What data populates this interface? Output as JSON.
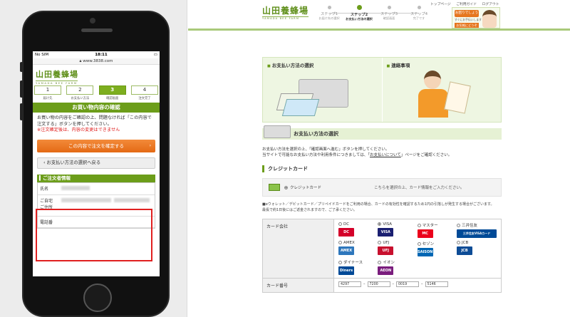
{
  "phone": {
    "status_carrier": "No SIM",
    "status_time": "18:11",
    "url": "www.3838.com",
    "logo_jp": "山田養蜂場",
    "logo_en": "YAMADA BEE FARM",
    "steps": [
      {
        "num": "1",
        "label": "届け先"
      },
      {
        "num": "2",
        "label": "お支払い方法"
      },
      {
        "num": "3",
        "label": "確認画面"
      },
      {
        "num": "4",
        "label": "注文完了"
      }
    ],
    "heading": "お買い物内容の確認",
    "desc": "お買い物の内容をご確認の上、問題なければ「この内容で注文する」ボタンを押してください。",
    "desc_red": "※注文確定後は、内容の変更はできません",
    "confirm_button": "この内容で注文を確定する",
    "back_button": "お支払い方法の選択へ戻る",
    "section": "ご注文者情報",
    "rows": [
      {
        "label": "氏名"
      },
      {
        "label": "ご自宅\nご住所"
      },
      {
        "label": "電話番"
      }
    ]
  },
  "desktop": {
    "logo_jp": "山田養蜂場",
    "logo_en": "YAMADA BEE FARM",
    "top_links": [
      "トップページ",
      "ご利用ガイド",
      "ログアウト"
    ],
    "steps": [
      {
        "title": "ステップ1",
        "sub": "お届け先の選択"
      },
      {
        "title": "ステップ2",
        "sub": "お支払い方法の選択"
      },
      {
        "title": "ステップ3",
        "sub": "確認画面"
      },
      {
        "title": "ステップ4",
        "sub": "完了です"
      }
    ],
    "banner": {
      "line1": "お困りでしょうか？",
      "line2": "すぐにお手伝いします",
      "btn": "お気軽にどうぞ"
    },
    "card_payment_title": "お支払い方法の選択",
    "card_contact_title": "連絡事項",
    "section_title": "お支払い方法の選択",
    "desc_line1": "お支払い方法を選択の上、「確認画面へ進む」ボタンを押してください。",
    "desc_line2_pre": "当サイトで可能なお支払い方法や利用条件につきましては、「",
    "desc_link": "お支払いについて",
    "desc_line2_post": "」ページをご確認ください。",
    "credit_heading": "クレジットカード",
    "credit_option": "クレジットカード",
    "credit_note": "こちらを選択の上、カード情報をご入力ください。",
    "notes_line1": "■eウォレット／デビットカード／プリペイドカードをご利用の場合、カードの有効性を確認するため1円の引落しが発生する場合がございます。",
    "notes_line2": "最長で約1日後にはご返金されますので、ご了承ください。",
    "card_company_label": "カード会社",
    "brands": [
      {
        "name": "DC",
        "logo": "DC",
        "color": "#d4002a",
        "selected": false
      },
      {
        "name": "VISA",
        "logo": "VISA",
        "color": "#1a1f71",
        "selected": true
      },
      {
        "name": "マスター",
        "logo": "MC",
        "color": "#eb001b",
        "selected": false
      },
      {
        "name": "三井住友",
        "logo": "三井住友VISAカード",
        "color": "#004a97",
        "selected": false
      },
      {
        "name": "AMEX",
        "logo": "AMEX",
        "color": "#2e77bc",
        "selected": false
      },
      {
        "name": "UFJ",
        "logo": "UFJ",
        "color": "#c8102e",
        "selected": false
      },
      {
        "name": "セゾン",
        "logo": "SAISON",
        "color": "#0066b3",
        "selected": false
      },
      {
        "name": "JCB",
        "logo": "JCB",
        "color": "#0e4c96",
        "selected": false
      },
      {
        "name": "ダイナース",
        "logo": "Diners",
        "color": "#004a97",
        "selected": false
      },
      {
        "name": "イオン",
        "logo": "AEON",
        "color": "#7a1d7d",
        "selected": false
      }
    ],
    "card_number_label": "カード番号",
    "card_number": [
      "4297",
      "7200",
      "0019",
      "5146"
    ]
  },
  "colors": {
    "brand_green": "#6c9d1a",
    "highlight_red": "#e02020",
    "orange": "#e46a14"
  }
}
